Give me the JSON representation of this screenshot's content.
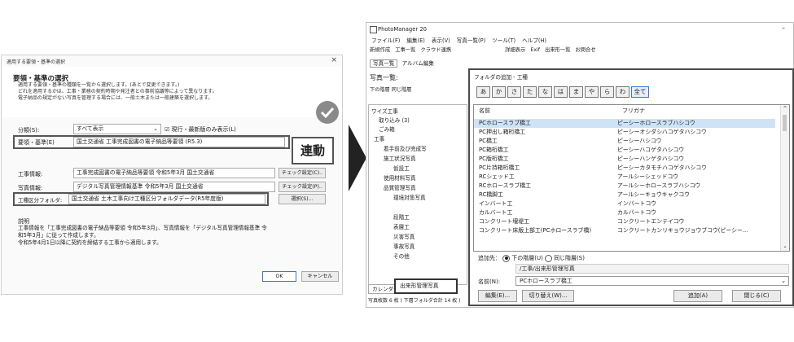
{
  "left_dialog": {
    "title": "適用する要領・基準の選択",
    "close": "×",
    "heading": "要領・基準の選択",
    "desc_lines": [
      "適用する要領・基準の種類を一覧から選択します。(あとで変更できます。)",
      "どれを適用するかは、工事・業務の契約時期や発注者との事前協議等によって異なります。",
      "電子納品の規定がない写真を管理する場合には、一般土木または一般建築を選択します。"
    ],
    "category_label": "分類(S):",
    "category_value": "すべて表示",
    "current_only": "現行・最新版のみ表示(L)",
    "standard_label": "要領・基準(E)",
    "standard_value": "国土交通省 工事完成図書の電子納品等要領 (R5.3)",
    "link_badge": "連動",
    "work_label": "工事情報:",
    "work_value": "工事完成図書の電子納品等要領 令和5年3月 国土交通省",
    "work_btn": "チェック設定(C)..",
    "photo_label": "写真情報:",
    "photo_value": "デジタル写真管理情報基準 令和5年3月 国土交通省",
    "photo_btn": "チェック設定(P)..",
    "folder_label": "工種区分フォルダ:",
    "folder_value": "国土交通省 土木工事向け工種区分フォルダデータ(R5年度版)",
    "folder_btn": "選択(S)...",
    "explain_label": "説明",
    "explain_lines": [
      "工事情報を「工事完成図書の電子納品等要領 令和5年3月」、写真情報を「デジタル写真管理情報基準 令",
      "和5年3月」に従って作成します。",
      "令和5年4月1日以降に契約を締結する工事から適用します。"
    ],
    "ok": "OK",
    "cancel": "キャンセル"
  },
  "app": {
    "title": "PhotoManager 20",
    "minimize": "–",
    "menu": [
      "ファイル(F)",
      "編集(E)",
      "表示(V)",
      "写真一覧(P)",
      "ツール(T)",
      "ヘルプ(H)"
    ],
    "toolbar": [
      "新規作成",
      "工事一覧",
      "クラウド連携",
      "詳細表示",
      "Exif",
      "出来形一覧",
      "お問合せ"
    ],
    "tabs": [
      "写真一覧",
      "アルバム編集"
    ],
    "list_label": "写真一覧:",
    "nav_down": "下の階層",
    "nav_same": "同じ階層",
    "tree": [
      "ワイズ工事",
      "取り込み (3)",
      "ごみ箱",
      "工事",
      "着手前及び完成写",
      "施工状況写真",
      "仮設工",
      "使用材料写真",
      "品質管理写真",
      "環境対策写真",
      "出来形管理写真",
      "段階工",
      "表層工",
      "災害写真",
      "事故写真",
      "その他"
    ],
    "calendar": "カレンダー",
    "status": "写真枚数 6 枚 ( 下層フォルダ合計 14 枚 )"
  },
  "folder_dialog": {
    "title": "フォルダの追加 - 工種",
    "kana": [
      "あ",
      "か",
      "さ",
      "た",
      "な",
      "は",
      "ま",
      "や",
      "ら",
      "わ",
      "全て"
    ],
    "col_name": "名前",
    "col_kana": "フリガナ",
    "rows": [
      [
        "PCホロースラブ橋工",
        "ピーシーホロースラブハシコウ"
      ],
      [
        "PC押出し箱桁橋工",
        "ピーシーオシダシハコゲタハシコウ"
      ],
      [
        "PC橋工",
        "ピーシーハシコウ"
      ],
      [
        "PC箱桁橋工",
        "ピーシーハコゲタハシコウ"
      ],
      [
        "PC版桁橋工",
        "ピーシーハンゲタハシコウ"
      ],
      [
        "PC片持箱桁橋工",
        "ピーシーカタモチハコゲタハシコウ"
      ],
      [
        "RCシェッド工",
        "アールシーシェッドコウ"
      ],
      [
        "RCホロースラブ橋工",
        "アールシーホロースラブハシコウ"
      ],
      [
        "RC橋脚工",
        "アールシーキョウキャクコウ"
      ],
      [
        "インバート工",
        "インバートコウ"
      ],
      [
        "カルバート工",
        "カルバートコウ"
      ],
      [
        "コンクリート堰堤工",
        "コンクリートエンテイコウ"
      ],
      [
        "コンクリート床版上部工(PCホロースラブ橋)",
        "コンクリートカンリキョウジョウブコウ(ピーシー..."
      ]
    ],
    "add_to_label": "追加先：",
    "opt_lower": "下の階層(U)",
    "opt_same": "同じ階層(S)",
    "path": "/工事/出来形管理写真",
    "name_label": "名前(N):",
    "name_value": "PCホロースラブ橋工",
    "btn_edit": "編集(E)...",
    "btn_switch": "切り替え(W)...",
    "btn_add": "追加(A)",
    "btn_close": "閉じる(C)"
  }
}
